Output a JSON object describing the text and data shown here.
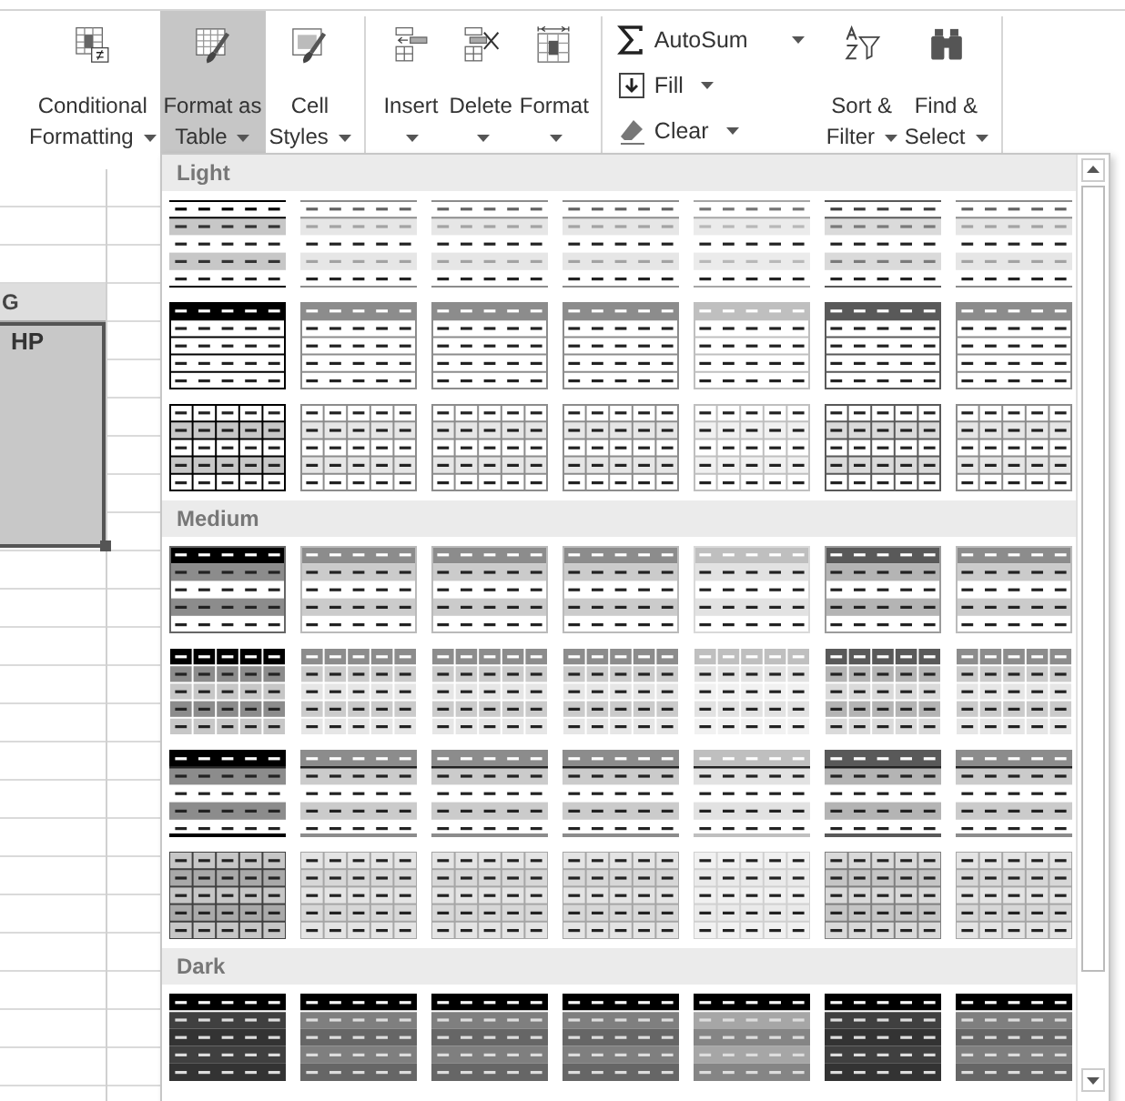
{
  "ribbon": {
    "groups": [
      {
        "buttons": [
          {
            "kind": "large",
            "label": [
              "Conditional",
              "Formatting"
            ],
            "dropdown": true,
            "pressed": false
          },
          {
            "kind": "large",
            "label": [
              "Format as",
              "Table"
            ],
            "dropdown": true,
            "pressed": true
          },
          {
            "kind": "large",
            "label": [
              "Cell",
              "Styles"
            ],
            "dropdown": true,
            "pressed": false
          }
        ]
      },
      {
        "buttons": [
          {
            "kind": "large",
            "label": [
              "Insert"
            ],
            "dropdown": true,
            "pressed": false
          },
          {
            "kind": "large",
            "label": [
              "Delete"
            ],
            "dropdown": true,
            "pressed": false
          },
          {
            "kind": "large",
            "label": [
              "Format"
            ],
            "dropdown": true,
            "pressed": false
          }
        ]
      },
      {
        "buttons": [
          {
            "kind": "small",
            "label": [
              "AutoSum"
            ],
            "dropdown": true,
            "pressed": false
          },
          {
            "kind": "small",
            "label": [
              "Fill"
            ],
            "dropdown": true,
            "pressed": false
          },
          {
            "kind": "small",
            "label": [
              "Clear"
            ],
            "dropdown": true,
            "pressed": false
          },
          {
            "kind": "large",
            "label": [
              "Sort &",
              "Filter"
            ],
            "dropdown": true,
            "pressed": false
          },
          {
            "kind": "large",
            "label": [
              "Find &",
              "Select"
            ],
            "dropdown": true,
            "pressed": false
          }
        ]
      }
    ]
  },
  "sheet": {
    "column_header": "G",
    "cell": "HP",
    "selected": true
  },
  "gallery": {
    "sections": [
      {
        "label": "Light",
        "rows": [
          {
            "kind": "banded-lines",
            "styles": [
              {
                "color": "#000000"
              },
              {
                "color": "#8c8c8c"
              },
              {
                "color": "#8c8c8c"
              },
              {
                "color": "#8c8c8c"
              },
              {
                "color": "#a6a6a6"
              },
              {
                "color": "#595959"
              },
              {
                "color": "#8c8c8c"
              }
            ]
          },
          {
            "kind": "header-rows",
            "styles": [
              {
                "color": "#000000"
              },
              {
                "color": "#8c8c8c"
              },
              {
                "color": "#8c8c8c"
              },
              {
                "color": "#8c8c8c"
              },
              {
                "color": "#bfbfbf"
              },
              {
                "color": "#595959"
              },
              {
                "color": "#8c8c8c"
              }
            ]
          },
          {
            "kind": "grid",
            "styles": [
              {
                "color": "#000000"
              },
              {
                "color": "#8c8c8c"
              },
              {
                "color": "#8c8c8c"
              },
              {
                "color": "#8c8c8c"
              },
              {
                "color": "#bfbfbf"
              },
              {
                "color": "#595959"
              },
              {
                "color": "#8c8c8c"
              }
            ]
          }
        ]
      },
      {
        "label": "Medium",
        "rows": [
          {
            "kind": "medium-header",
            "styles": [
              {
                "color": "#000000"
              },
              {
                "color": "#8c8c8c"
              },
              {
                "color": "#8c8c8c"
              },
              {
                "color": "#8c8c8c"
              },
              {
                "color": "#bfbfbf"
              },
              {
                "color": "#595959"
              },
              {
                "color": "#8c8c8c"
              }
            ]
          },
          {
            "kind": "medium-grid",
            "styles": [
              {
                "color": "#000000"
              },
              {
                "color": "#8c8c8c"
              },
              {
                "color": "#8c8c8c"
              },
              {
                "color": "#8c8c8c"
              },
              {
                "color": "#bfbfbf"
              },
              {
                "color": "#595959"
              },
              {
                "color": "#8c8c8c"
              }
            ]
          },
          {
            "kind": "medium-rule",
            "styles": [
              {
                "color": "#000000"
              },
              {
                "color": "#8c8c8c"
              },
              {
                "color": "#8c8c8c"
              },
              {
                "color": "#8c8c8c"
              },
              {
                "color": "#bfbfbf"
              },
              {
                "color": "#595959"
              },
              {
                "color": "#8c8c8c"
              }
            ]
          },
          {
            "kind": "medium-tint",
            "styles": [
              {
                "color": "#404040"
              },
              {
                "color": "#a6a6a6"
              },
              {
                "color": "#a6a6a6"
              },
              {
                "color": "#a6a6a6"
              },
              {
                "color": "#d0d0d0"
              },
              {
                "color": "#7f7f7f"
              },
              {
                "color": "#a6a6a6"
              }
            ]
          }
        ]
      },
      {
        "label": "Dark",
        "rows": [
          {
            "kind": "dark",
            "styles": [
              {
                "color": "#404040"
              },
              {
                "color": "#7f7f7f"
              },
              {
                "color": "#7f7f7f"
              },
              {
                "color": "#7f7f7f"
              },
              {
                "color": "#a6a6a6"
              },
              {
                "color": "#404040"
              },
              {
                "color": "#7f7f7f"
              }
            ]
          }
        ]
      }
    ]
  }
}
